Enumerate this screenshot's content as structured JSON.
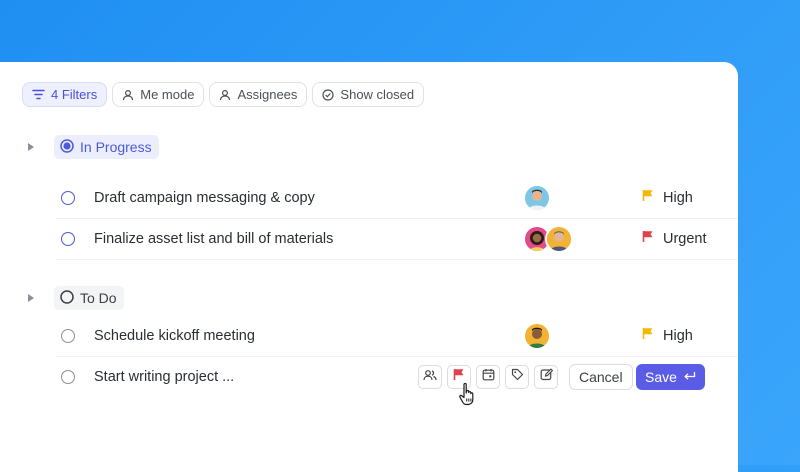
{
  "filters": {
    "items": [
      {
        "label": "4 Filters",
        "icon": "filter-icon"
      },
      {
        "label": "Me mode",
        "icon": "person-icon"
      },
      {
        "label": "Assignees",
        "icon": "person-icon"
      },
      {
        "label": "Show closed",
        "icon": "check-circle-icon"
      }
    ]
  },
  "groups": {
    "in_progress": {
      "label": "In Progress",
      "color": "#4d5ad8",
      "tasks": [
        {
          "name": "Draft campaign messaging & copy",
          "priority": "High",
          "priority_color": "#f2b707"
        },
        {
          "name": "Finalize asset list and bill of materials",
          "priority": "Urgent",
          "priority_color": "#e0424b"
        }
      ]
    },
    "todo": {
      "label": "To Do",
      "tasks": [
        {
          "name": "Schedule kickoff meeting",
          "priority": "High",
          "priority_color": "#f2b707"
        }
      ],
      "new_task": {
        "value": "Start writing project ...",
        "tools": [
          "assignees-icon",
          "flag-icon",
          "calendar-icon",
          "tag-icon",
          "edit-icon"
        ],
        "cancel_label": "Cancel",
        "save_label": "Save"
      }
    }
  },
  "colors": {
    "accent": "#5b5ce6",
    "background_blue": "#2f9cf7"
  }
}
